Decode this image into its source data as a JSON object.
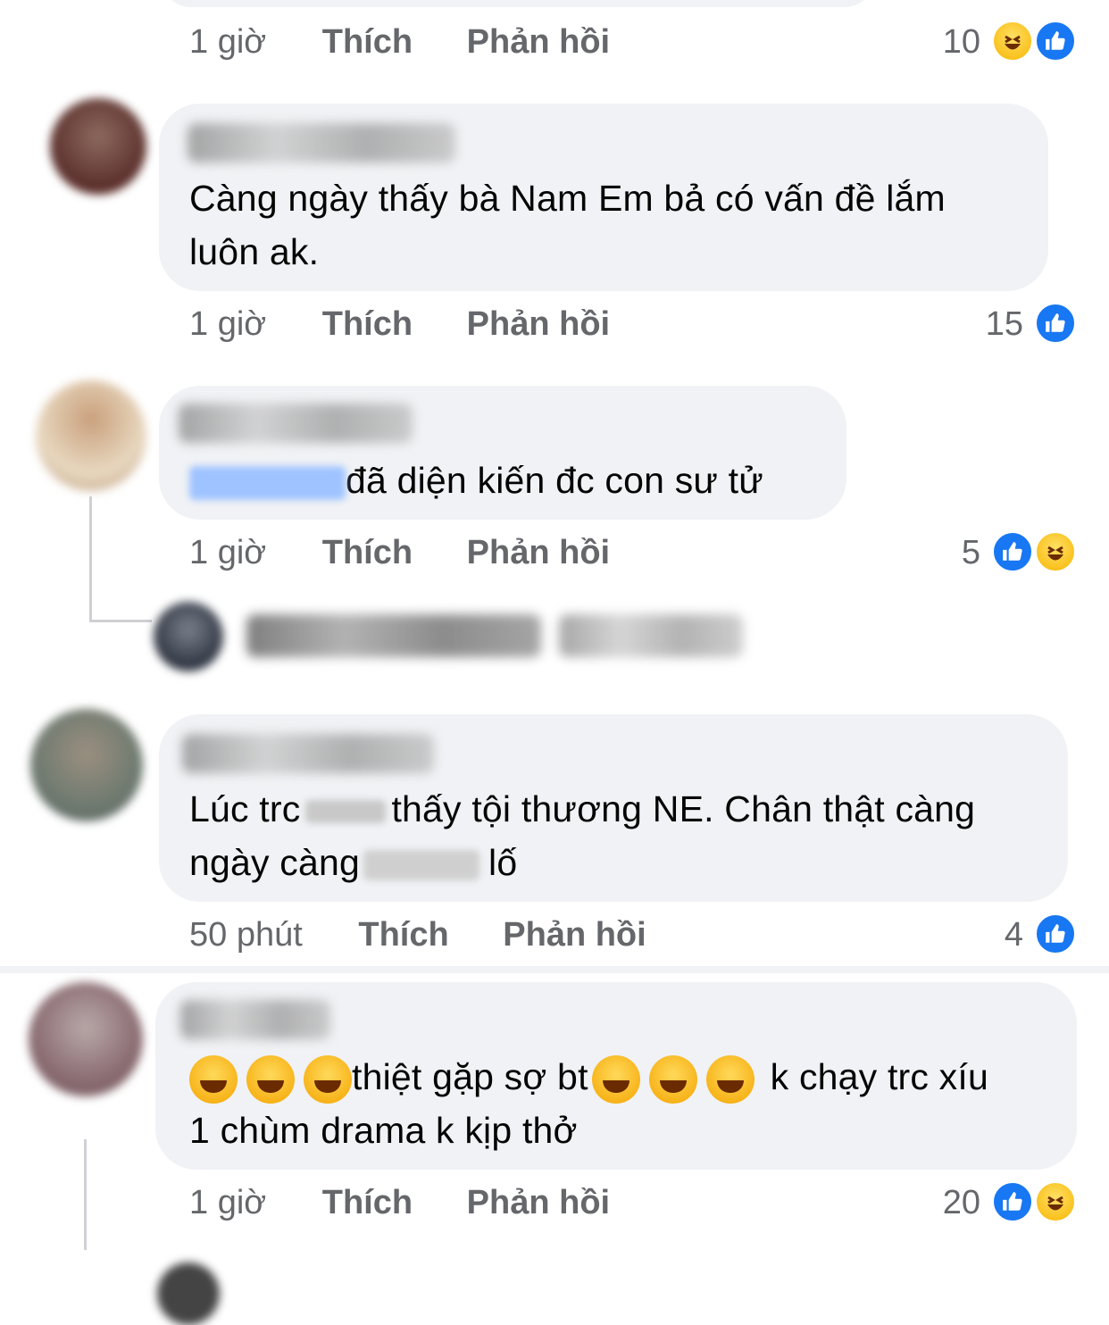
{
  "comments": [
    {
      "time": "1 giờ",
      "like": "Thích",
      "reply": "Phản hồi",
      "count": "10",
      "reactions": [
        "haha",
        "like"
      ]
    },
    {
      "time": "1 giờ",
      "like": "Thích",
      "reply": "Phản hồi",
      "count": "15",
      "reactions": [
        "like"
      ],
      "text1": "Càng ngày thấy bà Nam Em bả có vấn đề lắm",
      "text2": "luôn ak."
    },
    {
      "time": "1 giờ",
      "like": "Thích",
      "reply": "Phản hồi",
      "count": "5",
      "reactions": [
        "like",
        "haha"
      ],
      "text1": "đã diện kiến đc con sư tử"
    },
    {
      "time": "50 phút",
      "like": "Thích",
      "reply": "Phản hồi",
      "count": "4",
      "reactions": [
        "like"
      ],
      "text1a": "Lúc trc",
      "text1b": "thấy tội thương NE. Chân thật càng",
      "text2a": "ngày càng",
      "text2b": "lố"
    },
    {
      "time": "1 giờ",
      "like": "Thích",
      "reply": "Phản hồi",
      "count": "20",
      "reactions": [
        "like",
        "haha"
      ],
      "text1a": "thiệt gặp sợ bt",
      "text1b": "k chạy trc xíu",
      "text2": "1 chùm drama k kịp thở"
    }
  ],
  "colors": {
    "like": "#1877f2",
    "bubble": "#f0f2f5",
    "meta": "#65676b"
  }
}
